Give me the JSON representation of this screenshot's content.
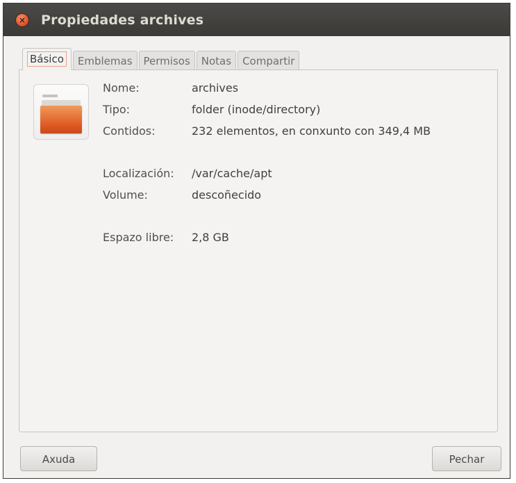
{
  "window": {
    "title": "Propiedades archives",
    "close_glyph": "×"
  },
  "tabs": [
    {
      "label": "Básico",
      "active": true
    },
    {
      "label": "Emblemas",
      "active": false
    },
    {
      "label": "Permisos",
      "active": false
    },
    {
      "label": "Notas",
      "active": false
    },
    {
      "label": "Compartir",
      "active": false
    }
  ],
  "icon": {
    "name": "folder-icon"
  },
  "properties": {
    "name_label": "Nome:",
    "name_value": "archives",
    "type_label": "Tipo:",
    "type_value": "folder (inode/directory)",
    "contents_label": "Contidos:",
    "contents_value": "232 elementos, en conxunto con 349,4 MB",
    "location_label": "Localización:",
    "location_value": "/var/cache/apt",
    "volume_label": "Volume:",
    "volume_value": "descoñecido",
    "free_label": "Espazo libre:",
    "free_value": "2,8 GB"
  },
  "buttons": {
    "help": "Axuda",
    "close": "Pechar"
  },
  "colors": {
    "titlebar": "#3c3b37",
    "close_button": "#e2552b",
    "folder": "#df5a23",
    "window_bg": "#f2f1f0"
  }
}
